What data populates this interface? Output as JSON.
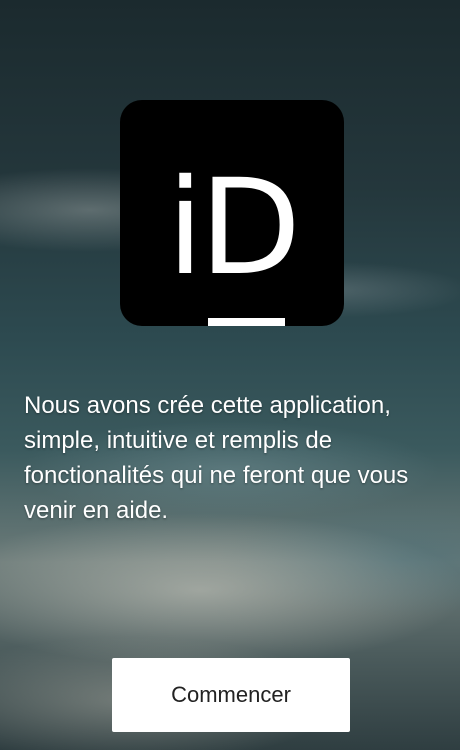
{
  "logo": {
    "text": "iD",
    "icon": "id-logo"
  },
  "intro": {
    "text": "Nous avons crée cette application, simple, intuitive et remplis de fonctionalités qui ne feront que vous venir en aide."
  },
  "start_button": {
    "label": "Commencer"
  },
  "colors": {
    "logo_background": "#000000",
    "button_background": "#ffffff",
    "text": "#ffffff"
  }
}
